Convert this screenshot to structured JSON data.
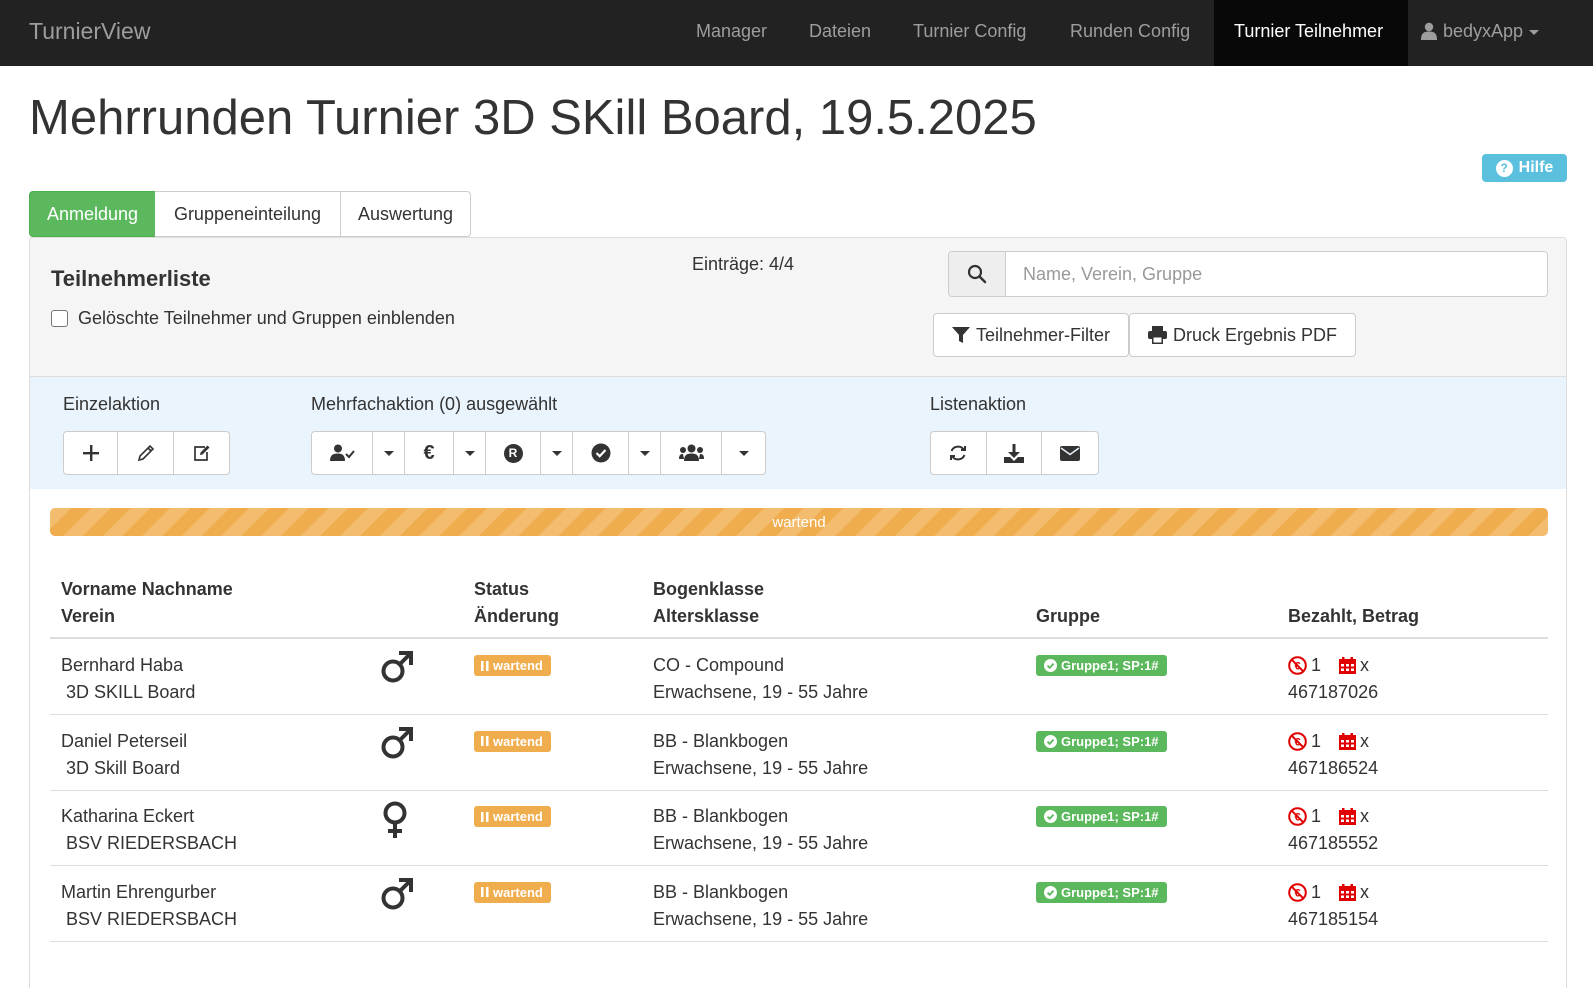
{
  "navbar": {
    "brand": "TurnierView",
    "items": [
      "Manager",
      "Dateien",
      "Turnier Config",
      "Runden Config",
      "Turnier Teilnehmer"
    ],
    "active_item": "Turnier Teilnehmer",
    "user": "bedyxApp"
  },
  "page": {
    "title": "Mehrrunden Turnier 3D SKill Board, 19.5.2025",
    "help_label": "Hilfe"
  },
  "tabs": [
    "Anmeldung",
    "Gruppeneinteilung",
    "Auswertung"
  ],
  "active_tab": "Anmeldung",
  "panel": {
    "title": "Teilnehmerliste",
    "entries": "Einträge: 4/4",
    "show_deleted_label": "Gelöschte Teilnehmer und Gruppen einblenden",
    "search_placeholder": "Name, Verein, Gruppe",
    "filter_button": "Teilnehmer-Filter",
    "print_button": "Druck Ergebnis PDF"
  },
  "actions": {
    "single_label": "Einzelaktion",
    "multi_label": "Mehrfachaktion (0) ausgewählt",
    "list_label": "Listenaktion"
  },
  "progress": {
    "label": "wartend",
    "fraction": 1.0,
    "color": "#f0ad4e"
  },
  "table": {
    "headers": {
      "name": "Vorname Nachname",
      "club": "Verein",
      "status": "Status",
      "change": "Änderung",
      "bow_class": "Bogenklasse",
      "age_class": "Altersklasse",
      "group": "Gruppe",
      "payment": "Bezahlt, Betrag"
    },
    "rows": [
      {
        "name": "Bernhard Haba",
        "club": "3D SKILL Board",
        "gender": "male",
        "status": "wartend",
        "bow_class": "CO - Compound",
        "age_class": "Erwachsene, 19 - 55 Jahre",
        "group": "Gruppe1; SP:1#",
        "paid_count": "1",
        "paid_x": "x",
        "amount": "467187026"
      },
      {
        "name": "Daniel Peterseil",
        "club": "3D Skill Board",
        "gender": "male",
        "status": "wartend",
        "bow_class": "BB - Blankbogen",
        "age_class": "Erwachsene, 19 - 55 Jahre",
        "group": "Gruppe1; SP:1#",
        "paid_count": "1",
        "paid_x": "x",
        "amount": "467186524"
      },
      {
        "name": "Katharina Eckert",
        "club": "BSV RIEDERSBACH",
        "gender": "female",
        "status": "wartend",
        "bow_class": "BB - Blankbogen",
        "age_class": "Erwachsene, 19 - 55 Jahre",
        "group": "Gruppe1; SP:1#",
        "paid_count": "1",
        "paid_x": "x",
        "amount": "467185552"
      },
      {
        "name": "Martin Ehrengurber",
        "club": "BSV RIEDERSBACH",
        "gender": "male",
        "status": "wartend",
        "bow_class": "BB - Blankbogen",
        "age_class": "Erwachsene, 19 - 55 Jahre",
        "group": "Gruppe1; SP:1#",
        "paid_count": "1",
        "paid_x": "x",
        "amount": "467185154"
      }
    ]
  },
  "colors": {
    "navbar": "#222222",
    "success": "#5cb85c",
    "warning": "#f0ad4e",
    "info": "#5bc0de",
    "danger": "#e00000"
  }
}
